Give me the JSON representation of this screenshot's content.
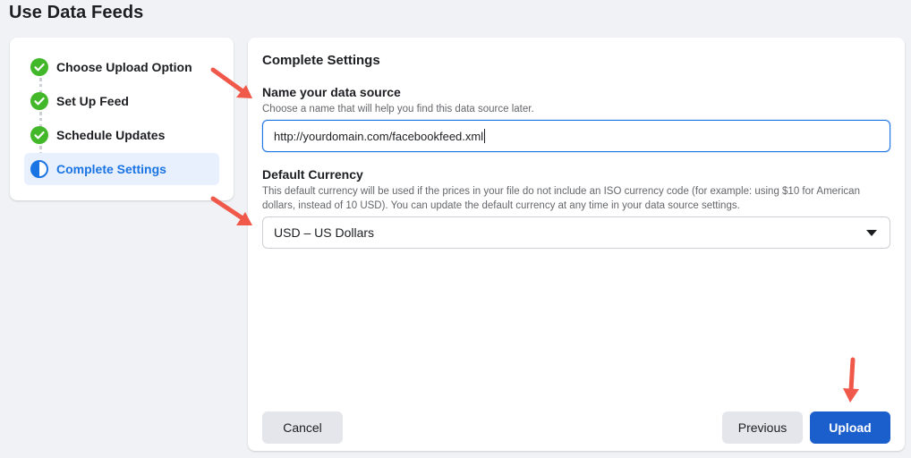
{
  "page": {
    "title": "Use Data Feeds"
  },
  "steps": [
    {
      "label": "Choose Upload Option",
      "status": "complete",
      "icon": "check-circle-icon"
    },
    {
      "label": "Set Up Feed",
      "status": "complete",
      "icon": "check-circle-icon"
    },
    {
      "label": "Schedule Updates",
      "status": "complete",
      "icon": "check-circle-icon"
    },
    {
      "label": "Complete Settings",
      "status": "active",
      "icon": "half-circle-icon"
    }
  ],
  "form": {
    "title": "Complete Settings",
    "name_field": {
      "label": "Name your data source",
      "help": "Choose a name that will help you find this data source later.",
      "value": "http://yourdomain.com/facebookfeed.xml"
    },
    "currency_field": {
      "label": "Default Currency",
      "help": "This default currency will be used if the prices in your file do not include an ISO currency code (for example: using $10 for American dollars, instead of 10 USD). You can update the default currency at any time in your data source settings.",
      "selected": "USD – US Dollars"
    }
  },
  "buttons": {
    "cancel": "Cancel",
    "previous": "Previous",
    "upload": "Upload"
  },
  "colors": {
    "accent": "#1b74e4",
    "success": "#42b72a",
    "primary_button": "#1b5fcc",
    "annotation_arrow": "#f0584a"
  }
}
